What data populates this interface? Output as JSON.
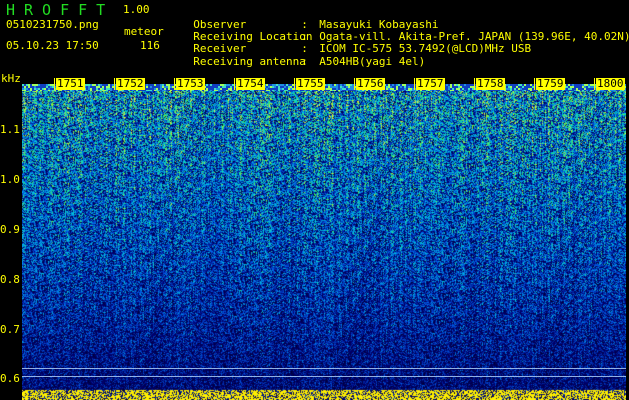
{
  "app": {
    "logo": "HROFFT",
    "version": "1.00",
    "filename": "0510231750.png",
    "datetime": "05.10.23 17:50",
    "meteor_label": "meteor",
    "meteor_count": "116"
  },
  "info": [
    {
      "label": "Observer",
      "value": "Masayuki Kobayashi"
    },
    {
      "label": "Receiving Location",
      "value": "Ogata-vill. Akita-Pref. JAPAN (139.96E, 40.02N)"
    },
    {
      "label": "Receiver",
      "value": "ICOM IC-575 53.7492(@LCD)MHz USB"
    },
    {
      "label": "Receiving antenna",
      "value": "A504HB(yagi 4el)"
    }
  ],
  "axis": {
    "unit": "kHz",
    "y_ticks": [
      "1.1",
      "1.0",
      "0.9",
      "0.8",
      "0.7",
      "0.6"
    ],
    "time_ticks": [
      "1751",
      "1752",
      "1753",
      "1754",
      "1755",
      "1756",
      "1757",
      "1758",
      "1759",
      "1800"
    ]
  },
  "colors": {
    "text": "#ffff00",
    "logo": "#22dd22",
    "background": "#000000"
  }
}
